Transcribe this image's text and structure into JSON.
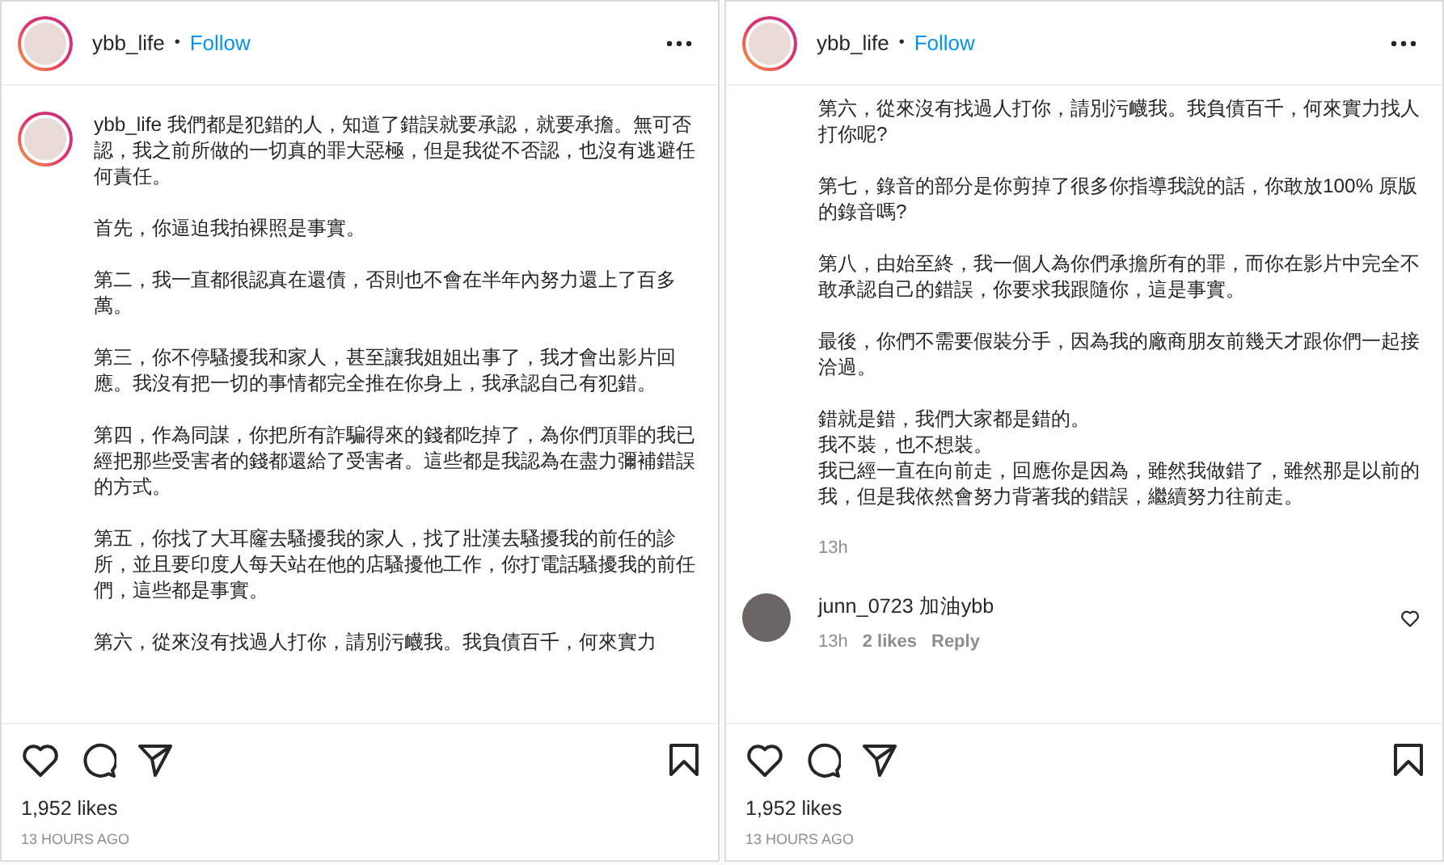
{
  "posts": [
    {
      "header": {
        "username": "ybb_life",
        "separator": "•",
        "follow": "Follow"
      },
      "caption": {
        "username": "ybb_life",
        "paragraphs": [
          [
            "我們都是犯錯的人，知道了錯誤就要承認，就要承擔。無可否認，我之前所做的一切真的罪大惡極，但是我從不否認，也沒有逃避任何責任。"
          ],
          [
            "首先，你逼迫我拍裸照是事實。"
          ],
          [
            "第二，我一直都很認真在還債，否則也不會在半年內努力還上了百多萬。"
          ],
          [
            "第三，你不停騷擾我和家人，甚至讓我姐姐出事了，我才會出影片回應。我沒有把一切的事情都完全推在你身上，我承認自己有犯錯。"
          ],
          [
            "第四，作為同謀，你把所有詐騙得來的錢都吃掉了，為你們頂罪的我已經把那些受害者的錢都還給了受害者。這些都是我認為在盡力彌補錯誤的方式。"
          ],
          [
            "第五，你找了大耳窿去騷擾我的家人，找了壯漢去騷擾我的前任的診所，並且要印度人每天站在他的店騷擾他工作，你打電話騷擾我的前任們，這些都是事實。"
          ],
          [
            "第六，從來沒有找過人打你，請別污衊我。我負債百千，何來實力"
          ]
        ]
      },
      "likes": "1,952 likes",
      "date": "13 HOURS AGO"
    },
    {
      "header": {
        "username": "ybb_life",
        "separator": "•",
        "follow": "Follow"
      },
      "caption": {
        "paragraphs": [
          [
            "第六，從來沒有找過人打你，請別污衊我。我負債百千，何來實力找人打你呢?"
          ],
          [
            "第七，錄音的部分是你剪掉了很多你指導我說的話，你敢放100% 原版的錄音嗎?"
          ],
          [
            "第八，由始至終，我一個人為你們承擔所有的罪，而你在影片中完全不敢承認自己的錯誤，你要求我跟隨你，這是事實。"
          ],
          [
            "最後，你們不需要假裝分手，因為我的廠商朋友前幾天才跟你們一起接洽過。"
          ],
          [
            "錯就是錯，我們大家都是錯的。",
            "我不裝，也不想裝。",
            "我已經一直在向前走，回應你是因為，雖然我做錯了，雖然那是以前的我，但是我依然會努力背著我的錯誤，繼續努力往前走。"
          ]
        ],
        "time": "13h"
      },
      "comments": [
        {
          "username": "junn_0723",
          "text": "加油ybb",
          "time": "13h",
          "likes": "2 likes",
          "reply": "Reply"
        }
      ],
      "likes": "1,952 likes",
      "date": "13 HOURS AGO"
    }
  ]
}
